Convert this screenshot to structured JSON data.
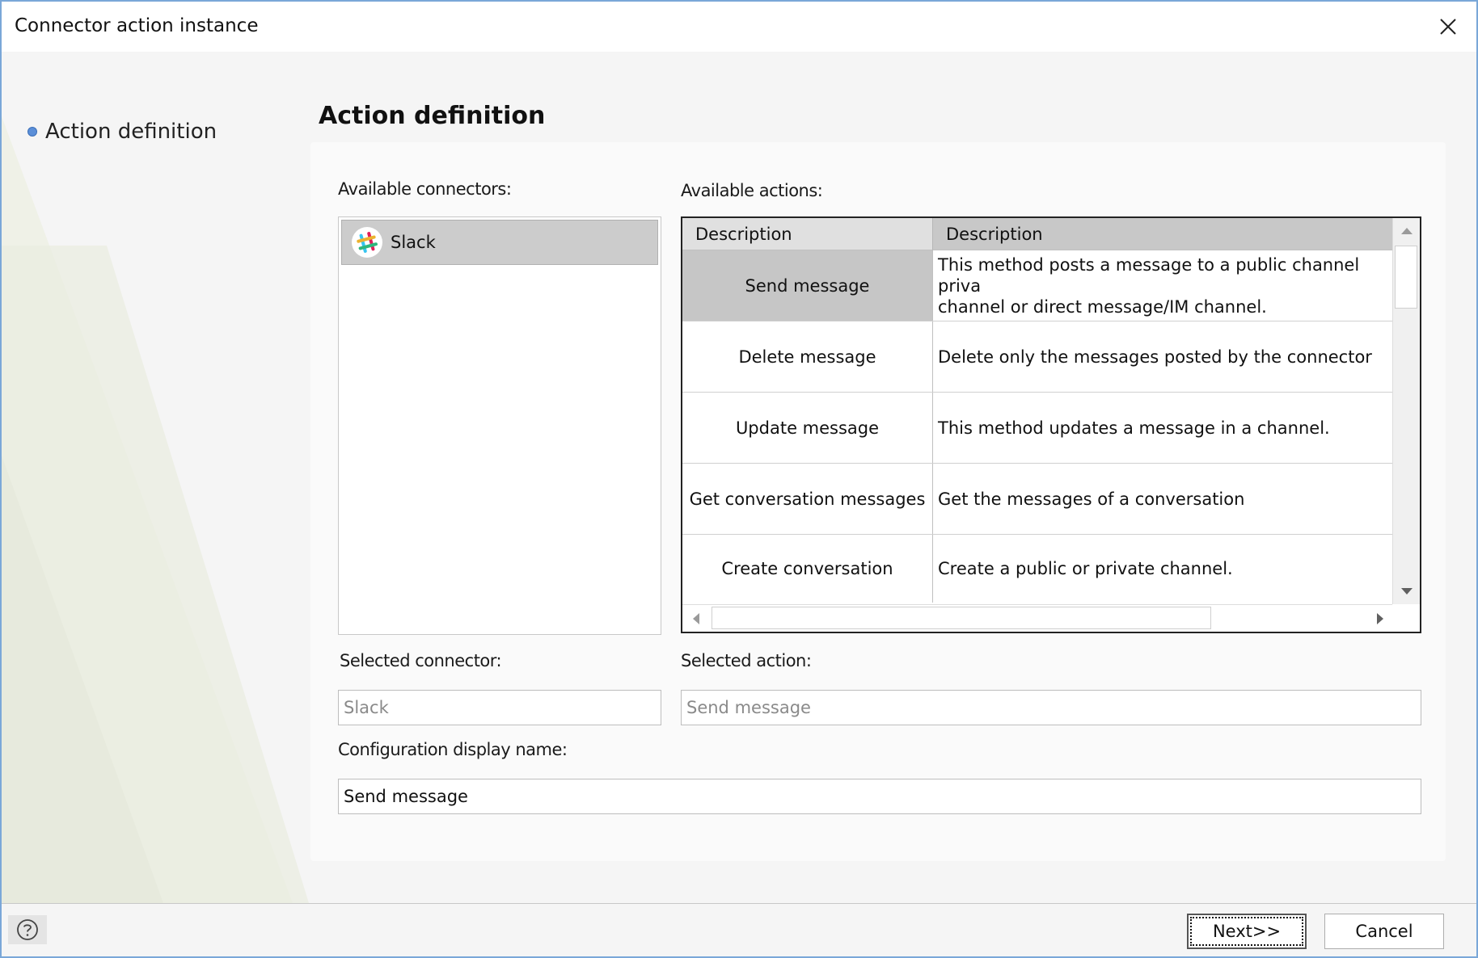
{
  "window": {
    "title": "Connector action instance"
  },
  "nav": {
    "items": [
      {
        "label": "Action definition"
      }
    ]
  },
  "main": {
    "title": "Action definition",
    "available_connectors_label": "Available connectors:",
    "available_actions_label": "Available actions:",
    "connectors": [
      {
        "label": "Slack",
        "icon": "slack-logo",
        "selected": true
      }
    ],
    "actions_grid": {
      "columns": [
        "Description",
        "Description"
      ],
      "rows": [
        {
          "name": "Send message",
          "description": "This method posts a message to a public channel private channel or direct message/IM channel.",
          "description_line1": "This method posts a message to a public channel priva",
          "description_line2": "channel or direct message/IM channel.",
          "selected": true
        },
        {
          "name": "Delete message",
          "description": "Delete only the messages posted by the connector"
        },
        {
          "name": "Update message",
          "description": "This method updates a message in a channel."
        },
        {
          "name": "Get conversation messages",
          "description": "Get the messages of a conversation"
        },
        {
          "name": "Create conversation",
          "description": "Create a public or private channel."
        }
      ]
    },
    "selected_connector_label": "Selected connector:",
    "selected_connector_value": "Slack",
    "selected_action_label": "Selected action:",
    "selected_action_value": "Send message",
    "config_name_label": "Configuration display name:",
    "config_name_value": "Send message"
  },
  "footer": {
    "help_icon": "question-circle-icon",
    "next_label": "Next>>",
    "cancel_label": "Cancel"
  },
  "colors": {
    "window_border": "#7aa7d8",
    "nav_dot": "#5b8fd8",
    "selected_row": "#c6c6c6",
    "selected_connector": "#cccccc"
  }
}
